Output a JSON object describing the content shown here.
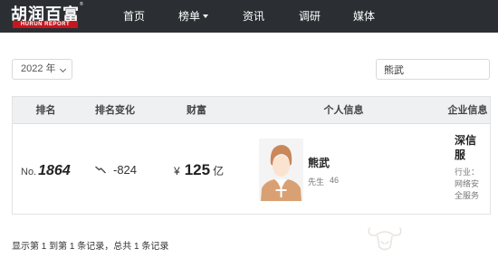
{
  "brand": {
    "name_cn": "胡润百富",
    "name_en": "HURUN REPORT",
    "registered": "®"
  },
  "nav": {
    "items": [
      "首页",
      "榜单",
      "资讯",
      "调研",
      "媒体"
    ]
  },
  "filters": {
    "year_value": "2022 年",
    "search_value": "熊武"
  },
  "table": {
    "headers": [
      "排名",
      "排名变化",
      "财富",
      "个人信息",
      "企业信息"
    ],
    "rows": [
      {
        "rank_prefix": "No.",
        "rank": "1864",
        "rank_change": "-824",
        "wealth_symbol": "¥",
        "wealth_amount": "125",
        "wealth_unit": "亿",
        "person_name": "熊武",
        "person_gender": "先生",
        "person_age": "46",
        "company_name": "深信服",
        "company_industry": "行业：网络安全服务"
      }
    ]
  },
  "pagination": {
    "summary": "显示第 1 到第 1 条记录，总共 1 条记录"
  },
  "icons": {
    "trend": "trend-down-icon",
    "avatar": "person-avatar-icon",
    "watermark": "ox-logo-icon"
  },
  "colors": {
    "nav_bg": "#2b2f33",
    "brand_red": "#c8161e",
    "table_header_bg": "#eef0f2"
  }
}
